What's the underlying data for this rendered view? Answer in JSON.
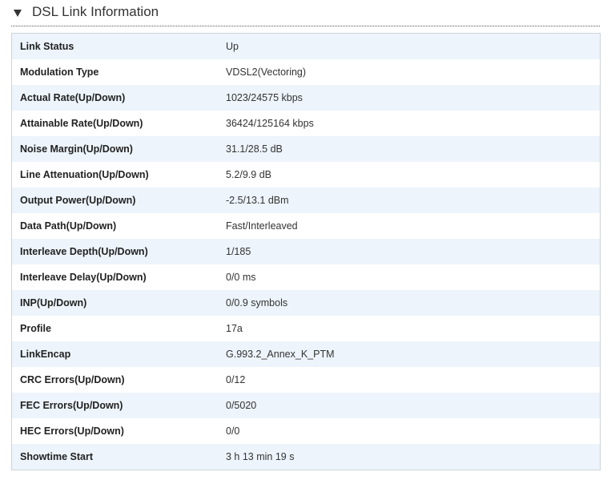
{
  "section": {
    "title": "DSL Link Information"
  },
  "rows": [
    {
      "label": "Link Status",
      "value": "Up"
    },
    {
      "label": "Modulation Type",
      "value": "VDSL2(Vectoring)"
    },
    {
      "label": "Actual Rate(Up/Down)",
      "value": "1023/24575 kbps"
    },
    {
      "label": "Attainable Rate(Up/Down)",
      "value": "36424/125164 kbps"
    },
    {
      "label": "Noise Margin(Up/Down)",
      "value": "31.1/28.5 dB"
    },
    {
      "label": "Line Attenuation(Up/Down)",
      "value": "5.2/9.9 dB"
    },
    {
      "label": "Output Power(Up/Down)",
      "value": "-2.5/13.1 dBm"
    },
    {
      "label": "Data Path(Up/Down)",
      "value": "Fast/Interleaved"
    },
    {
      "label": "Interleave Depth(Up/Down)",
      "value": "1/185"
    },
    {
      "label": "Interleave Delay(Up/Down)",
      "value": "0/0 ms"
    },
    {
      "label": "INP(Up/Down)",
      "value": "0/0.9 symbols"
    },
    {
      "label": "Profile",
      "value": "17a"
    },
    {
      "label": "LinkEncap",
      "value": "G.993.2_Annex_K_PTM"
    },
    {
      "label": "CRC Errors(Up/Down)",
      "value": "0/12"
    },
    {
      "label": "FEC Errors(Up/Down)",
      "value": "0/5020"
    },
    {
      "label": "HEC Errors(Up/Down)",
      "value": "0/0"
    },
    {
      "label": "Showtime Start",
      "value": "3 h 13 min 19 s"
    }
  ]
}
